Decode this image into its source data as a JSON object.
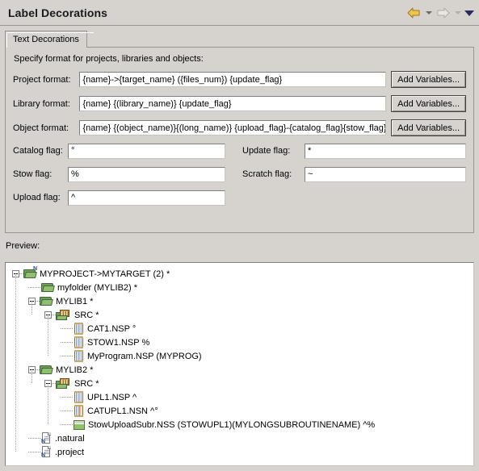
{
  "window": {
    "title": "Label Decorations"
  },
  "toolbar": {
    "back_icon": "back-arrow-icon",
    "back_menu_icon": "chevron-down-icon",
    "forward_icon": "forward-arrow-icon",
    "forward_menu_icon": "chevron-down-icon",
    "menu_icon": "chevron-down-icon"
  },
  "tabs": [
    {
      "label": "Text Decorations",
      "selected": true
    }
  ],
  "form": {
    "hint": "Specify format for projects, libraries and objects:",
    "fields": [
      {
        "label": "Project format:",
        "value": "{name}->{target_name} ({files_num}) {update_flag}",
        "button": "Add Variables..."
      },
      {
        "label": "Library format:",
        "value": "{name} {(library_name)} {update_flag}",
        "button": "Add Variables..."
      },
      {
        "label": "Object format:",
        "value": "{name} {(object_name)}{(long_name)} {upload_flag}-{catalog_flag}{stow_flag}",
        "button": "Add Variables..."
      }
    ],
    "flags": [
      {
        "label": "Catalog flag:",
        "value": "°"
      },
      {
        "label": "Update flag:",
        "value": "*"
      },
      {
        "label": "Stow flag:",
        "value": "%"
      },
      {
        "label": "Scratch flag:",
        "value": "~"
      },
      {
        "label": "Upload flag:",
        "value": "^"
      }
    ]
  },
  "preview": {
    "label": "Preview:",
    "tree": [
      {
        "text": "MYPROJECT->MYTARGET (2) *",
        "icon": "project-folder-icon",
        "depth": 0,
        "expander": "collapse"
      },
      {
        "text": "myfolder (MYLIB2) *",
        "icon": "folder-icon",
        "depth": 1,
        "expander": "none"
      },
      {
        "text": "MYLIB1 *",
        "icon": "folder-icon",
        "depth": 1,
        "expander": "collapse"
      },
      {
        "text": "SRC *",
        "icon": "library-icon",
        "depth": 2,
        "expander": "collapse"
      },
      {
        "text": "CAT1.NSP °",
        "icon": "nsp-file-icon",
        "depth": 3,
        "expander": "none"
      },
      {
        "text": "STOW1.NSP %",
        "icon": "nsp-file-icon",
        "depth": 3,
        "expander": "none"
      },
      {
        "text": "MyProgram.NSP (MYPROG)",
        "icon": "nsp-file-icon",
        "depth": 3,
        "expander": "none"
      },
      {
        "text": "MYLIB2 *",
        "icon": "folder-icon",
        "depth": 1,
        "expander": "collapse"
      },
      {
        "text": "SRC *",
        "icon": "library-icon",
        "depth": 2,
        "expander": "collapse"
      },
      {
        "text": "UPL1.NSP ^",
        "icon": "nsp-file-icon",
        "depth": 3,
        "expander": "none"
      },
      {
        "text": "CATUPL1.NSN ^°",
        "icon": "nsn-file-icon",
        "depth": 3,
        "expander": "none"
      },
      {
        "text": "StowUploadSubr.NSS (STOWUPL1)(MYLONGSUBROUTINENAME) ^%",
        "icon": "nss-file-icon",
        "depth": 3,
        "expander": "none"
      },
      {
        "text": ".natural",
        "icon": "natural-doc-icon",
        "depth": 1,
        "expander": "none"
      },
      {
        "text": ".project",
        "icon": "project-doc-icon",
        "depth": 1,
        "expander": "none"
      }
    ]
  },
  "colors": {
    "window_bg": "#d6d3ce",
    "field_bg": "#ffffff",
    "border": "#9a968f",
    "folder_green": "#8fbf6f",
    "back_arrow_gold": "#e8b53a",
    "forward_arrow_gray": "#cfcbc4",
    "menu_navy": "#2b2a5e"
  }
}
